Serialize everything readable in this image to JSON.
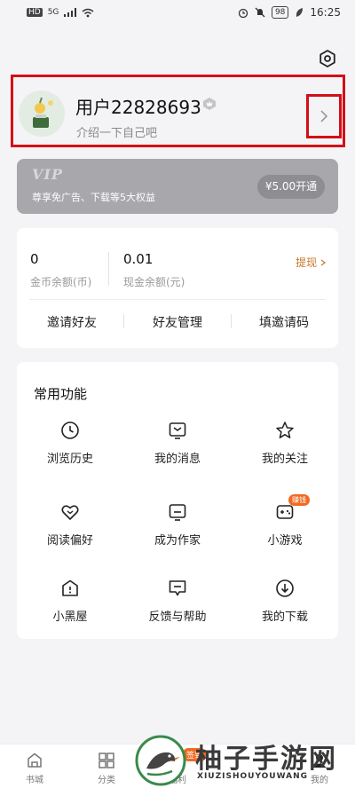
{
  "status": {
    "left_badges": [
      "HD",
      "5G"
    ],
    "time": "16:25",
    "battery": "98"
  },
  "profile": {
    "username": "用户22828693",
    "intro": "介绍一下自己吧"
  },
  "vip": {
    "logo": "VIP",
    "desc": "尊享免广告、下载等5大权益",
    "button": "¥5.00开通"
  },
  "wallet": {
    "coins_value": "0",
    "coins_label": "金币余额(币)",
    "cash_value": "0.01",
    "cash_label": "现金余额(元)",
    "withdraw": "提现",
    "actions": [
      "邀请好友",
      "好友管理",
      "填邀请码"
    ]
  },
  "functions": {
    "title": "常用功能",
    "items": [
      {
        "label": "浏览历史",
        "icon": "clock-icon"
      },
      {
        "label": "我的消息",
        "icon": "message-icon"
      },
      {
        "label": "我的关注",
        "icon": "star-icon"
      },
      {
        "label": "阅读偏好",
        "icon": "heart-icon"
      },
      {
        "label": "成为作家",
        "icon": "author-icon"
      },
      {
        "label": "小游戏",
        "icon": "gamepad-icon",
        "badge": "赚钱"
      },
      {
        "label": "小黑屋",
        "icon": "house-icon"
      },
      {
        "label": "反馈与帮助",
        "icon": "feedback-icon"
      },
      {
        "label": "我的下载",
        "icon": "download-icon"
      }
    ]
  },
  "tabbar": {
    "items": [
      "书城",
      "分类",
      "福利",
      "我的"
    ],
    "badge": "签到"
  },
  "watermark": {
    "title": "柚子手游网",
    "sub": "XIUZISHOUYOUWANG"
  }
}
